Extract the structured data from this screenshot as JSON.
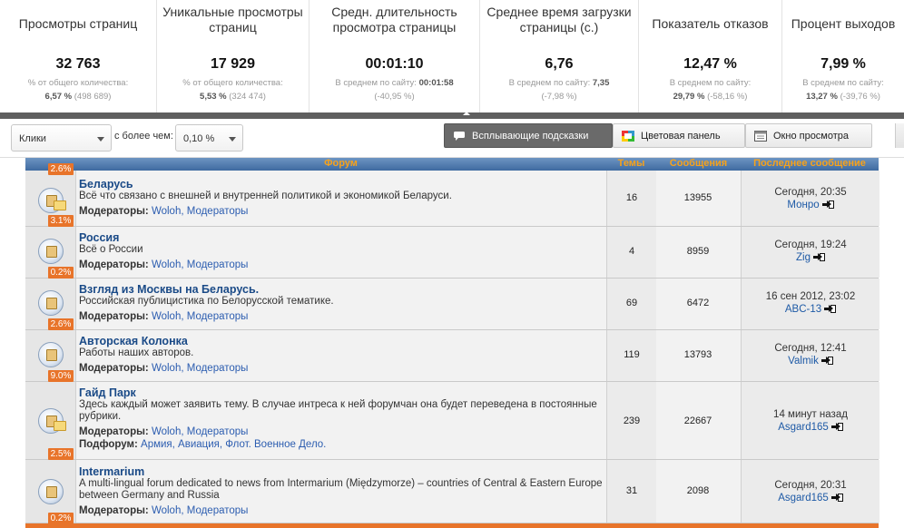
{
  "stats": [
    {
      "title": "Просмотры страниц",
      "value": "32 763",
      "sub1": "% от общего количества:",
      "sub2_bold": "6,57 %",
      "sub2_rest": "(498 689)"
    },
    {
      "title": "Уникальные просмотры страниц",
      "value": "17 929",
      "sub1": "% от общего количества:",
      "sub2_bold": "5,53 %",
      "sub2_rest": "(324 474)"
    },
    {
      "title": "Средн. длительность просмотра страницы",
      "value": "00:01:10",
      "sub1": "В среднем по сайту:",
      "sub1_bold": "00:01:58",
      "sub2_bold": "",
      "sub2_rest": "(-40,95 %)"
    },
    {
      "title": "Среднее время загрузки страницы (с.)",
      "value": "6,76",
      "sub1": "В среднем по сайту:",
      "sub1_bold": "7,35",
      "sub2_bold": "",
      "sub2_rest": "(-7,98 %)"
    },
    {
      "title": "Показатель отказов",
      "value": "12,47 %",
      "sub1": "В среднем по сайту:",
      "sub2_bold": "29,79 %",
      "sub2_rest": "(-58,16 %)"
    },
    {
      "title": "Процент выходов",
      "value": "7,99 %",
      "sub1": "В среднем по сайту:",
      "sub2_bold": "13,27 %",
      "sub2_rest": "(-39,76 %)"
    }
  ],
  "toolbar": {
    "metric_select": "Клики",
    "more_than": "с более чем:",
    "threshold_select": "0,10 %",
    "tooltips_btn": "Всплывающие подсказки",
    "colorbar_btn": "Цветовая панель",
    "viewer_btn": "Окно просмотра"
  },
  "forum": {
    "headers": {
      "forum": "Форум",
      "topics": "Темы",
      "posts": "Сообщения",
      "last": "Последнее сообщение"
    },
    "rows": [
      {
        "pct_top": "2.6%",
        "pct_bottom": "3.1%",
        "title": "Беларусь",
        "desc": "Всё что связано с внешней и внутренней политикой и экономикой Беларуси.",
        "mod_label": "Модераторы:",
        "mods": "Woloh, Модераторы",
        "topics": "16",
        "posts": "13955",
        "last_time": "Сегодня, 20:35",
        "last_user": "Монро"
      },
      {
        "pct_bottom": "0.2%",
        "title": "Россия",
        "desc": "Всё о России",
        "mod_label": "Модераторы:",
        "mods": "Woloh, Модераторы",
        "topics": "4",
        "posts": "8959",
        "last_time": "Сегодня, 19:24",
        "last_user": "Zig"
      },
      {
        "pct_bottom": "2.6%",
        "title": "Взгляд из Москвы на Беларусь.",
        "desc": "Российская публицистика по Белорусской тематике.",
        "mod_label": "Модераторы:",
        "mods": "Woloh, Модераторы",
        "topics": "69",
        "posts": "6472",
        "last_time": "16 сен 2012, 23:02",
        "last_user": "ABC-13"
      },
      {
        "pct_bottom": "9.0%",
        "title": "Авторская Колонка",
        "desc": "Работы наших авторов.",
        "mod_label": "Модераторы:",
        "mods": "Woloh, Модераторы",
        "topics": "119",
        "posts": "13793",
        "last_time": "Сегодня, 12:41",
        "last_user": "Valmik"
      },
      {
        "pct_bottom": "2.5%",
        "title": "Гайд Парк",
        "desc": "Здесь каждый может заявить тему. В случае интреса к ней форумчан она будет переведена в постоянные рубрики.",
        "mod_label": "Модераторы:",
        "mods": "Woloh, Модераторы",
        "sub_label": "Подфорум:",
        "subs": "Армия, Авиация, Флот. Военное Дело.",
        "topics": "239",
        "posts": "22667",
        "last_time": "14 минут назад",
        "last_user": "Asgard165"
      },
      {
        "pct_bottom": "0.2%",
        "title": "Intermarium",
        "desc": "A multi-lingual forum dedicated to news from Intermarium (Międzymorze) – countries of Central & Eastern Europe between Germany and Russia",
        "mod_label": "Модераторы:",
        "mods": "Woloh, Модераторы",
        "topics": "31",
        "posts": "2098",
        "last_time": "Сегодня, 20:31",
        "last_user": "Asgard165"
      }
    ]
  },
  "colors": {
    "accent_orange": "#e8742a",
    "header_blue": "#4a74a8",
    "link_blue": "#1a4a87"
  }
}
